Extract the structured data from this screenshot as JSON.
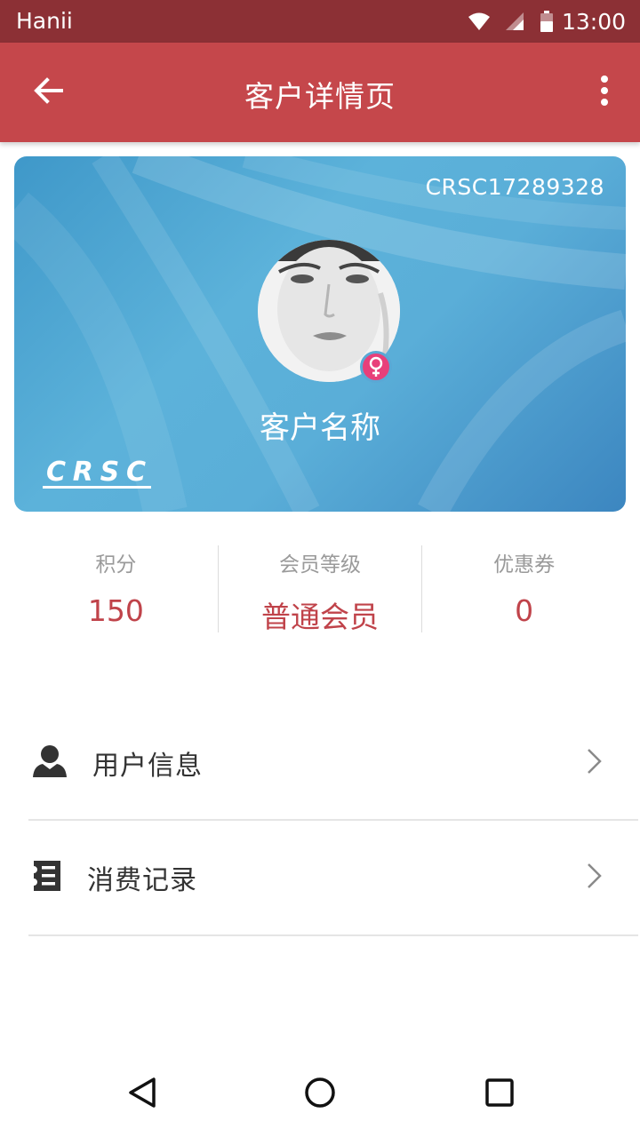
{
  "status_bar": {
    "carrier": "Hanii",
    "time": "13:00",
    "icons": [
      "wifi-icon",
      "signal-icon",
      "battery-icon"
    ]
  },
  "app_bar": {
    "title": "客户详情页",
    "back_icon": "arrow-left-icon",
    "more_icon": "more-vertical-icon",
    "background_color": "#c5474b"
  },
  "card": {
    "code": "CRSC17289328",
    "customer_name": "客户名称",
    "gender": "female",
    "gender_icon": "female-icon",
    "logo_text": "CRSC",
    "background_color": "#4aa3d3"
  },
  "stats": [
    {
      "label": "积分",
      "value": "150"
    },
    {
      "label": "会员等级",
      "value": "普通会员"
    },
    {
      "label": "优惠券",
      "value": "0"
    }
  ],
  "menu": [
    {
      "label": "用户信息",
      "icon": "user-icon"
    },
    {
      "label": "消费记录",
      "icon": "receipt-icon"
    }
  ],
  "nav_bar": {
    "icons": [
      "nav-back-icon",
      "nav-home-icon",
      "nav-recent-icon"
    ]
  },
  "accent_color": "#c0434a"
}
